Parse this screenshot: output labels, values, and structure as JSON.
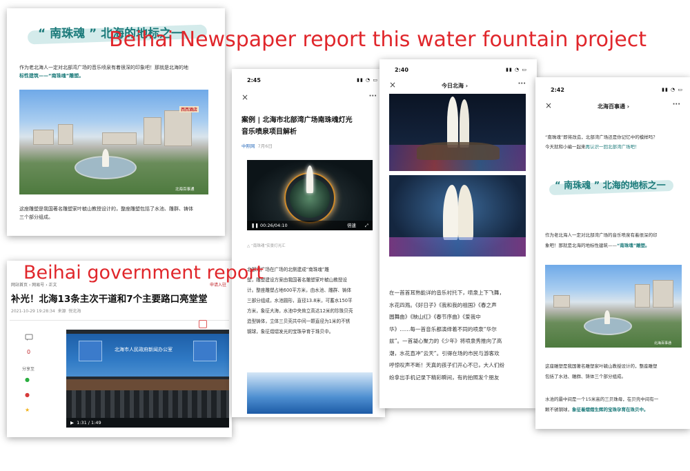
{
  "overlays": {
    "newspaper_caption": "Beihai Newspaper report this water fountain project",
    "government_caption": "Beihai government report"
  },
  "card1": {
    "heading": "“ 南珠魂 ” 北海的地标之一",
    "intro_line1": "作为老北海人一定对北部湾广场的音乐喷泉有着很深的印象吧！那就是北海的地",
    "intro_line2": "标性建筑——“南珠魂”雕塑。",
    "photo_sign": "西西酒店",
    "photo_watermark": "北海百事通",
    "outro_line1": "这座雕塑是我国著名雕塑家叶毓山教授设计的，整座雕塑包括了水池、雕群、铸体",
    "outro_line2": "三个部分组成。"
  },
  "card2": {
    "breadcrumb_home": "网站首页",
    "breadcrumb_sep1": "›",
    "breadcrumb_section": "网易号",
    "breadcrumb_sep2": "›",
    "breadcrumb_page": "正文",
    "top_right": "申请入驻",
    "headline": "补光！北海13条主次干道和7个主要路口亮堂堂",
    "meta_date": "2021-10-29 19:28:34",
    "meta_source": "来源",
    "meta_author": "悦北海",
    "comment_count": "0",
    "share_label": "分享至",
    "meeting_room_sign": "北海市人民政府新闻办公室",
    "video_time": "1:31 / 1:49"
  },
  "card3": {
    "time": "2:45",
    "close": "×",
    "more": "···",
    "title_line1": "案例 | 北海市北部湾广场南珠魂灯光",
    "title_line2": "音乐喷泉项目解析",
    "source": "中照网",
    "date": "7月6日",
    "video_time": "00:26/04:10",
    "speed": "倍速",
    "caption": "△ “南珠魂”实景灯光汇",
    "body_lines": [
      "北部湾广场在广场的北侧建成“南珠魂”雕",
      "塑，雕塑建设方案由我国著名雕塑家叶毓山教授设",
      "计。整座雕塑占地600平方米，由水池、雕群、铸体",
      "三部分组成，水池圆形，直径13.8米，可蓄水150平",
      "方米，象征大海，水池中央耸立高达12米的珍珠贝壳",
      "造型铸体，立体三贝壳共中间一颗直径为1米的不锈",
      "钢球，象征熠熠发光的宝珠孕育于珠贝中。"
    ]
  },
  "card4": {
    "time": "2:40",
    "close": "×",
    "title": "今日北海 ›",
    "more": "···",
    "body_lines": [
      "在一首首耳熟能详的音乐衬托下，喷泉上下飞舞，",
      "水花四溅。《好日子》《我和我的祖国》《春之声",
      "圆舞曲》《映山红》《春节序曲》《爱我中",
      "华》……每一首音乐都演绎着不同的喷泉“华尔",
      "兹”。一首凝心聚力的《少年》将喷泉秀推向了高",
      "潮，水花直冲“云天”。引得在场的市民与游客欢",
      "呼惊叹声不断！天真的孩子们开心不已，大人们纷",
      "纷拿出手机记录下精彩瞬间，有的拍照发个朋友"
    ]
  },
  "card5": {
    "time": "2:42",
    "close": "×",
    "title": "北海百事通 ›",
    "more": "···",
    "intro_line1": "“南珠魂”即将改造，北部湾广场还是你记忆中的模样吗？",
    "intro_line2a": "今天就和小编一起来",
    "intro_line2b": "再认识一回北部湾广场吧！",
    "heading": "“ 南珠魂 ” 北海的地标之一",
    "p1_line1": "作为老北海人一定对北部湾广场的音乐喷泉有着很深的印",
    "p1_line2a": "象吧！那就是北海的地标性建筑——",
    "p1_line2b": "“南珠魂”雕塑。",
    "photo_watermark": "北海百事通",
    "p2_line1": "这座雕塑是我国著名雕塑家叶毓山教授设计的，整座雕塑",
    "p2_line2": "包括了水池、雕群、铸体三个部分组成。",
    "p3_line1": "水池的最中间是一个15米高的三贝珠母，在贝壳中间有一",
    "p3_line2a": "颗不锈钢球，",
    "p3_line2b": "象征着熠熠生辉的宝珠孕育在珠贝中。"
  }
}
